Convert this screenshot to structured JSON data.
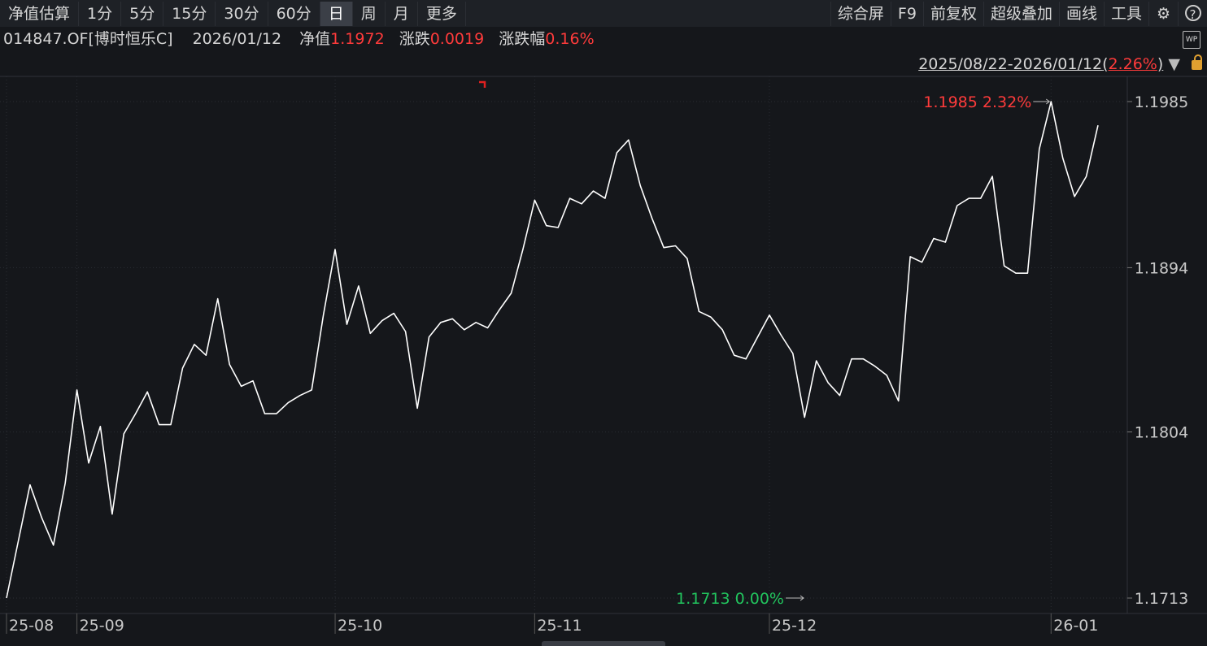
{
  "toolbar": {
    "left": [
      "净值估算",
      "1分",
      "5分",
      "15分",
      "30分",
      "60分",
      "日",
      "周",
      "月",
      "更多"
    ],
    "active": "日",
    "right": [
      "综合屏",
      "F9",
      "前复权",
      "超级叠加",
      "画线",
      "工具"
    ],
    "icons": [
      "gear-icon",
      "help-icon"
    ]
  },
  "info": {
    "code": "014847.OF[博时恒乐C]",
    "date": "2026/01/12",
    "nav_label": "净值",
    "nav_value": "1.1972",
    "change_label": "涨跌",
    "change_value": "0.0019",
    "pct_label": "涨跌幅",
    "pct_value": "0.16%",
    "wp_badge": "WP"
  },
  "range": {
    "dates": "2025/08/22-2026/01/12",
    "open": "(",
    "pct": "2.26%",
    "close": ")",
    "arrow": "▼"
  },
  "colors": {
    "up": "#ff3b3b",
    "down": "#22c55e",
    "line": "#ffffff",
    "bg": "#15171b"
  },
  "chart_data": {
    "type": "line",
    "series": [
      {
        "values": [
          1.1713,
          1.1744,
          1.1775,
          1.1757,
          1.1742,
          1.1776,
          1.1827,
          1.1787,
          1.1807,
          1.1759,
          1.1803,
          1.1814,
          1.1826,
          1.1808,
          1.1808,
          1.1839,
          1.1852,
          1.1846,
          1.1877,
          1.1841,
          1.1829,
          1.1832,
          1.1814,
          1.1814,
          1.182,
          1.1824,
          1.1827,
          1.1868,
          1.1904,
          1.1863,
          1.1884,
          1.1858,
          1.1865,
          1.1869,
          1.1859,
          1.1817,
          1.1856,
          1.1864,
          1.1866,
          1.186,
          1.1864,
          1.1861,
          1.1871,
          1.188,
          1.1904,
          1.1931,
          1.1917,
          1.1916,
          1.1932,
          1.1929,
          1.1936,
          1.1932,
          1.1957,
          1.1964,
          1.1939,
          1.1921,
          1.1905,
          1.1906,
          1.1899,
          1.187,
          1.1867,
          1.186,
          1.1846,
          1.1844,
          1.1856,
          1.1868,
          1.1857,
          1.1847,
          1.1812,
          1.1843,
          1.1831,
          1.1824,
          1.1844,
          1.1844,
          1.184,
          1.1835,
          1.1821,
          1.19,
          1.1897,
          1.191,
          1.1908,
          1.1928,
          1.1932,
          1.1932,
          1.1944,
          1.1895,
          1.1891,
          1.1891,
          1.1959,
          1.1985,
          1.1954,
          1.1933,
          1.1944,
          1.1972
        ]
      }
    ],
    "x_tick_labels": [
      "25-08",
      "25-09",
      "25-10",
      "25-11",
      "25-12",
      "26-01"
    ],
    "x_tick_index": [
      0,
      6,
      28,
      45,
      65,
      89
    ],
    "y_tick_labels": [
      "1.1985",
      "1.1894",
      "1.1804",
      "1.1713"
    ],
    "ylim": [
      1.1713,
      1.1985
    ],
    "max_label": "1.1985 2.32%",
    "min_label": "1.1713 0.00%",
    "max_index": 89,
    "min_index": 0
  }
}
